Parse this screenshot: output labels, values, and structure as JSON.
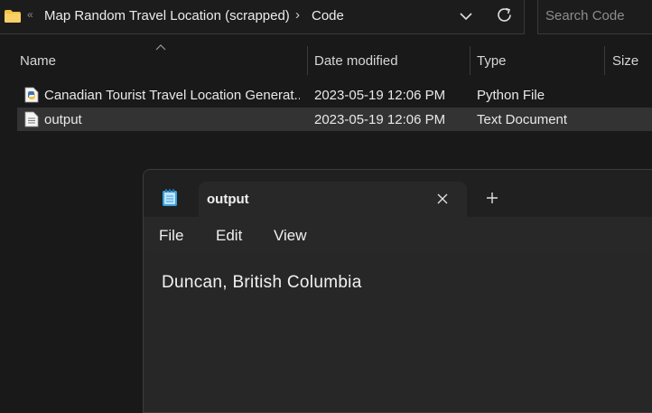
{
  "explorer": {
    "breadcrumb": {
      "overflow_glyph": "«",
      "items": [
        "Map Random Travel Location (scrapped)",
        "Code"
      ],
      "separator": "›"
    },
    "search": {
      "placeholder": "Search Code"
    },
    "columns": [
      "Name",
      "Date modified",
      "Type",
      "Size"
    ],
    "files": [
      {
        "name": "Canadian Tourist Travel Location Generat...",
        "date": "2023-05-19 12:06 PM",
        "type": "Python File",
        "icon": "python-file-icon",
        "selected": false
      },
      {
        "name": "output",
        "date": "2023-05-19 12:06 PM",
        "type": "Text Document",
        "icon": "text-file-icon",
        "selected": true
      }
    ]
  },
  "notepad": {
    "tab_title": "output",
    "menu": [
      "File",
      "Edit",
      "View"
    ],
    "content": "Duncan, British Columbia"
  },
  "colors": {
    "background": "#191919",
    "selected_row": "#333333",
    "folder": "#f5c242",
    "notepad_icon": "#3aa0e0"
  }
}
